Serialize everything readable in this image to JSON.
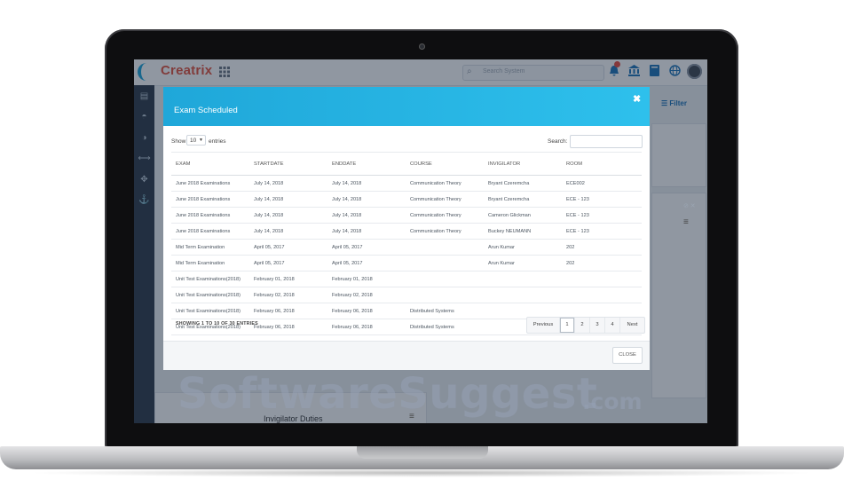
{
  "app": {
    "logo": "Creatrix",
    "search_placeholder": "Search System"
  },
  "topbar_icons": [
    "grid-icon",
    "bell-icon",
    "bank-icon",
    "book-icon",
    "globe-icon",
    "avatar"
  ],
  "sidebar_icons": [
    "document-icon",
    "dashboard-icon",
    "contrast-icon",
    "arrows-horizontal-icon",
    "move-icon",
    "anchor-icon"
  ],
  "background": {
    "filter_label": "Filter",
    "invigilator_title": "Invigilator Duties"
  },
  "modal": {
    "title": "Exam Scheduled",
    "close_symbol": "✖",
    "length": {
      "show_label": "Show",
      "selected": "10",
      "entries_label": "entries"
    },
    "search_label": "Search:",
    "columns": [
      "EXAM",
      "STARTDATE",
      "ENDDATE",
      "COURSE",
      "INVIGILATOR",
      "ROOM"
    ],
    "rows": [
      [
        "June 2018 Examinations",
        "July 14, 2018",
        "July 14, 2018",
        "Communication Theory",
        "Bryant Czeremcha",
        "ECE002"
      ],
      [
        "June 2018 Examinations",
        "July 14, 2018",
        "July 14, 2018",
        "Communication Theory",
        "Bryant Czeremcha",
        "ECE - 123"
      ],
      [
        "June 2018 Examinations",
        "July 14, 2018",
        "July 14, 2018",
        "Communication Theory",
        "Cameron Glickman",
        "ECE - 123"
      ],
      [
        "June 2018 Examinations",
        "July 14, 2018",
        "July 14, 2018",
        "Communication Theory",
        "Buckey NEUMANN",
        "ECE - 123"
      ],
      [
        "Mid Term Examination",
        "April 05, 2017",
        "April 05, 2017",
        "",
        "Arun Kumar",
        "202"
      ],
      [
        "Mid Term Examination",
        "April 05, 2017",
        "April 05, 2017",
        "",
        "Arun Kumar",
        "202"
      ],
      [
        "Unit Test Examinations(2018)",
        "February 01, 2018",
        "February 01, 2018",
        "",
        "",
        ""
      ],
      [
        "Unit Test Examinations(2018)",
        "February 02, 2018",
        "February 02, 2018",
        "",
        "",
        ""
      ],
      [
        "Unit Test Examinations(2018)",
        "February 06, 2018",
        "February 06, 2018",
        "Distributed Systems",
        "",
        ""
      ],
      [
        "Unit Test Examinations(2018)",
        "February 06, 2018",
        "February 06, 2018",
        "Distributed Systems",
        "",
        ""
      ]
    ],
    "info": "SHOWING 1 TO 10 OF 30 ENTRIES",
    "pagination": {
      "previous": "Previous",
      "pages": [
        "1",
        "2",
        "3",
        "4"
      ],
      "active_page": "1",
      "next": "Next"
    },
    "close_button": "CLOSE"
  },
  "watermark": {
    "text": "SoftwareSuggest",
    "tld": ".com"
  },
  "colors": {
    "modal_header": "#1fa7d9",
    "sidebar": "#2c3947",
    "logo": "#e2513d"
  }
}
